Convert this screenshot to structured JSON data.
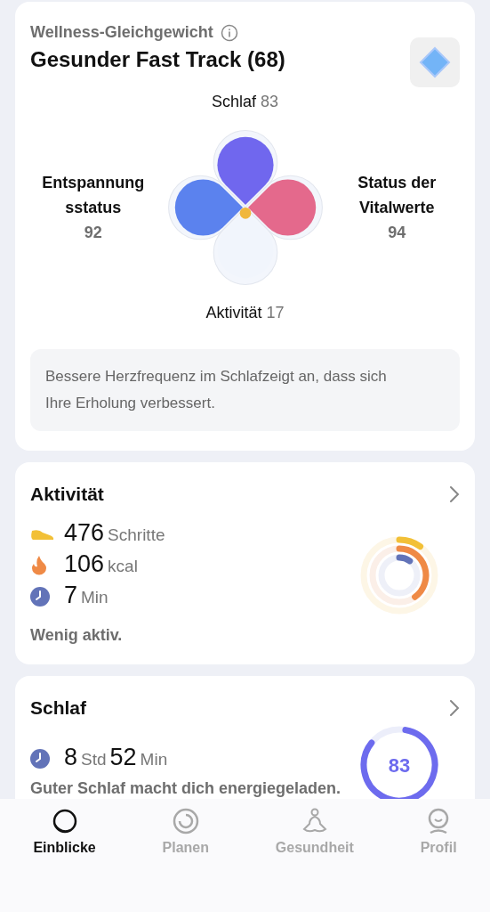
{
  "balance": {
    "overline": "Wellness-Gleichgewicht",
    "title": "Gesunder Fast Track (68)",
    "petals": [
      {
        "kind": "top",
        "label": "Schlaf",
        "value": "83",
        "color": "#7067ee"
      },
      {
        "kind": "left",
        "label": "Entspannung sstatus",
        "value": "92",
        "color": "#5b82ee"
      },
      {
        "kind": "right",
        "label": "Status der Vitalwerte",
        "value": "94",
        "color": "#e4698c"
      },
      {
        "kind": "bottom",
        "label": "Aktivität",
        "value": "17",
        "color": "#f1f5fc"
      }
    ],
    "insight": "Bessere Herzfrequenz im Schlafzeigt an, dass sich Ihre Erholung verbessert."
  },
  "activity": {
    "title": "Aktivität",
    "metrics": [
      {
        "kind": "steps",
        "number": "476",
        "unit": "Schritte"
      },
      {
        "kind": "calories",
        "number": "106",
        "unit": "kcal"
      },
      {
        "kind": "minutes",
        "number": "7",
        "unit": "Min"
      }
    ],
    "status": "Wenig aktiv."
  },
  "sleep": {
    "title": "Schlaf",
    "hours": "8",
    "hours_unit": "Std",
    "minutes": "52",
    "minutes_unit": "Min",
    "score": "83",
    "note": "Guter Schlaf macht dich energiegeladen."
  },
  "tabs": [
    {
      "kind": "insights",
      "label": "Einblicke",
      "selected": true
    },
    {
      "kind": "plan",
      "label": "Planen",
      "selected": false
    },
    {
      "kind": "health",
      "label": "Gesundheit",
      "selected": false
    },
    {
      "kind": "profile",
      "label": "Profil",
      "selected": false
    }
  ]
}
